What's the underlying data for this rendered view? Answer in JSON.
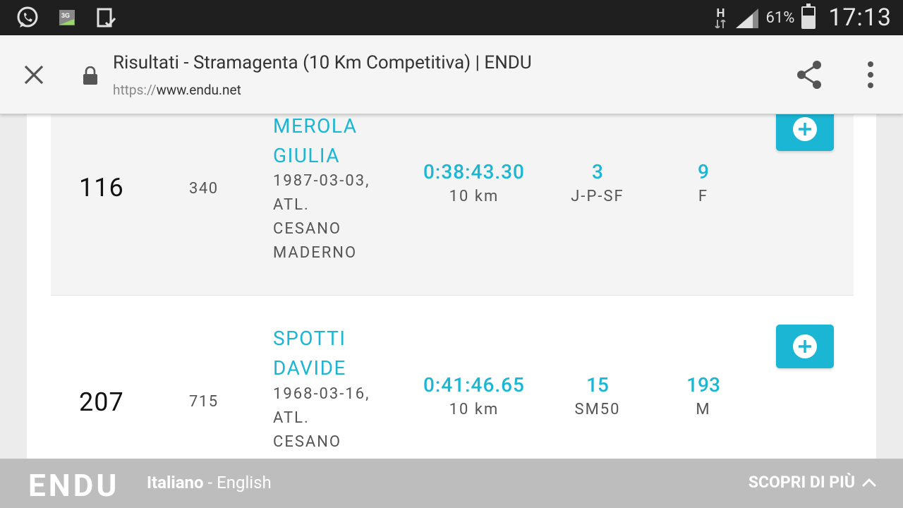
{
  "status_bar": {
    "icons_left": [
      "whatsapp-icon",
      "3g-data-icon",
      "download-complete-icon"
    ],
    "network_label": "H",
    "battery_percent": "61%",
    "battery_level": 0.61,
    "time": "17:13"
  },
  "tab": {
    "title": "Risultati - Stramagenta (10 Km Competitiva) | ENDU",
    "url_scheme": "https://",
    "url_host": "www.endu.net"
  },
  "results": [
    {
      "rank": "116",
      "bib": "340",
      "name_line1": "MEROLA",
      "name_line2": "GIULIA",
      "info": [
        "1987-03-03,",
        "ATL.",
        "CESANO",
        "MADERNO"
      ],
      "time": "0:38:43.30",
      "distance": "10 km",
      "category_rank": "3",
      "category": "J-P-SF",
      "sex_rank": "9",
      "sex": "F"
    },
    {
      "rank": "207",
      "bib": "715",
      "name_line1": "SPOTTI",
      "name_line2": "DAVIDE",
      "info": [
        "1968-03-16,",
        "ATL.",
        "CESANO"
      ],
      "time": "0:41:46.65",
      "distance": "10 km",
      "category_rank": "15",
      "category": "SM50",
      "sex_rank": "193",
      "sex": "M"
    }
  ],
  "footer": {
    "logo": "ENDU",
    "lang_active": "Italiano",
    "lang_sep": " - ",
    "lang_other": "English",
    "more_label": "SCOPRI DI PIÙ"
  },
  "colors": {
    "accent": "#1bb6d4",
    "footer_bg": "#bdbdbd",
    "status_bar_bg": "#1f1f1f"
  }
}
